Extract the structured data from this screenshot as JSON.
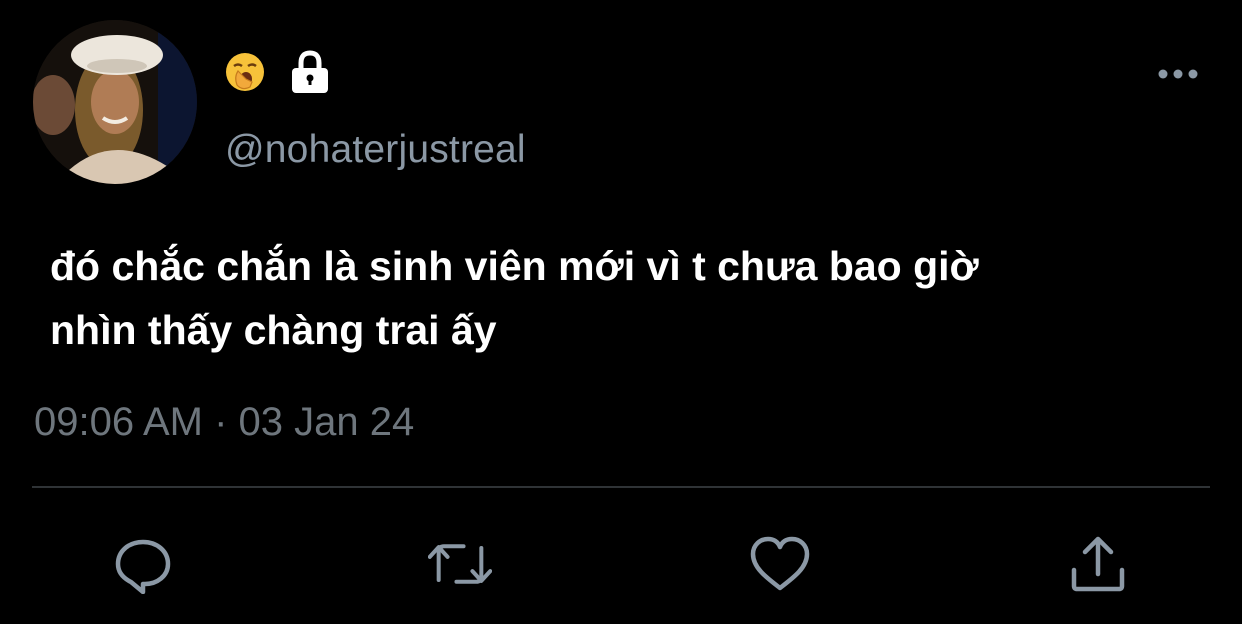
{
  "tweet": {
    "handle": "@nohaterjustreal",
    "text": "đó chắc chắn là sinh viên mới vì t chưa bao giờ\nnhìn thấy chàng trai ấy",
    "timestamp": "09:06 AM · 03 Jan 24"
  },
  "icons": {
    "name_emoji": "yawning-face-emoji",
    "protected": "lock-icon",
    "more": "more-options-icon",
    "reply": "reply-icon",
    "retweet": "retweet-icon",
    "like": "heart-icon",
    "share": "share-icon"
  },
  "colors": {
    "background": "#000000",
    "text_primary": "#ffffff",
    "text_secondary": "#8b98a5",
    "timestamp": "#6e767d",
    "divider": "#2f3336",
    "icon": "#8b98a5"
  }
}
